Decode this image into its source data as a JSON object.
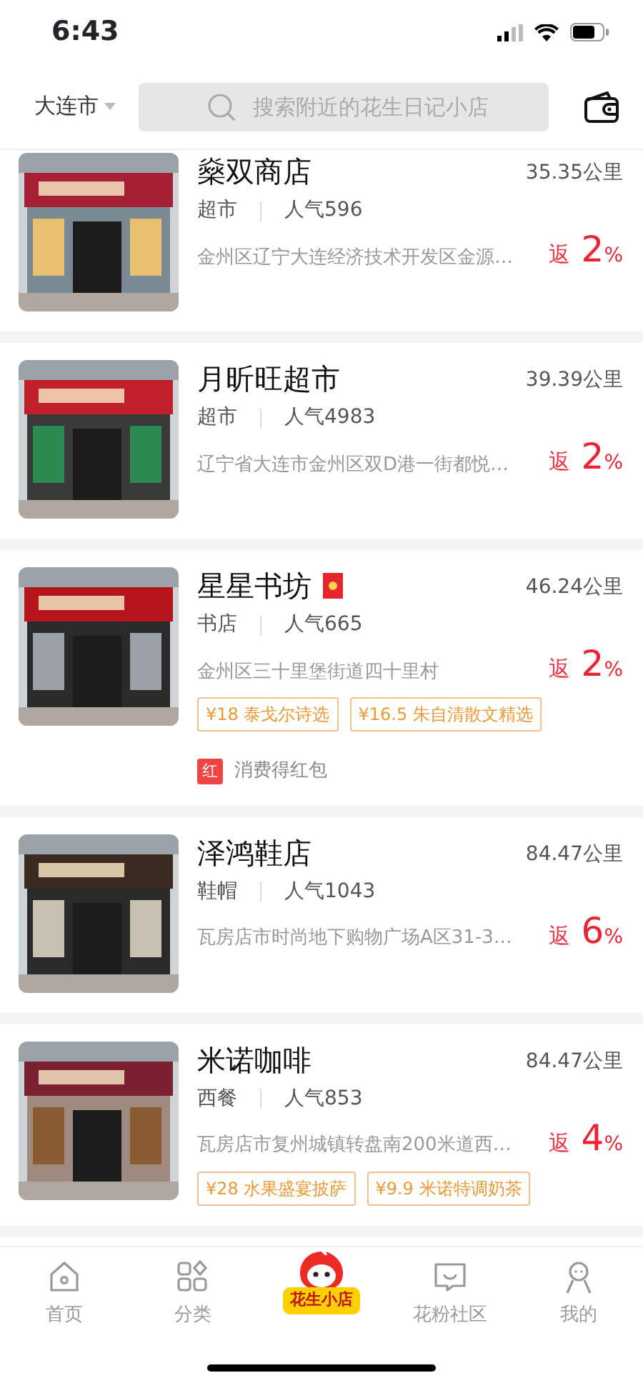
{
  "status_bar": {
    "time": "6:43"
  },
  "header": {
    "city": "大连市",
    "search": {
      "placeholder": "搜索附近的花生日记小店"
    }
  },
  "stores": [
    {
      "name": "燊双商店",
      "red_packet_icon": false,
      "distance": "35.35公里",
      "category": "超市",
      "popularity": "人气596",
      "address": "金州区辽宁大连经济技术开发区金源…",
      "rebate_label": "返",
      "rebate": "2",
      "rebate_unit": "%"
    },
    {
      "name": "月昕旺超市",
      "red_packet_icon": false,
      "distance": "39.39公里",
      "category": "超市",
      "popularity": "人气4983",
      "address": "辽宁省大连市金州区双D港一街都悦…",
      "rebate_label": "返",
      "rebate": "2",
      "rebate_unit": "%"
    },
    {
      "name": "星星书坊",
      "red_packet_icon": true,
      "distance": "46.24公里",
      "category": "书店",
      "popularity": "人气665",
      "address": "金州区三十里堡街道四十里村",
      "rebate_label": "返",
      "rebate": "2",
      "rebate_unit": "%",
      "tags": [
        "¥18 泰戈尔诗选",
        "¥16.5 朱自清散文精选"
      ],
      "promo": {
        "badge": "红",
        "text": "消费得红包"
      }
    },
    {
      "name": "泽鸿鞋店",
      "red_packet_icon": false,
      "distance": "84.47公里",
      "category": "鞋帽",
      "popularity": "人气1043",
      "address": "瓦房店市时尚地下购物广场A区31-3…",
      "rebate_label": "返",
      "rebate": "6",
      "rebate_unit": "%"
    },
    {
      "name": "米诺咖啡",
      "red_packet_icon": false,
      "distance": "84.47公里",
      "category": "西餐",
      "popularity": "人气853",
      "address": "瓦房店市复州城镇转盘南200米道西…",
      "rebate_label": "返",
      "rebate": "4",
      "rebate_unit": "%",
      "tags": [
        "¥28 水果盛宴披萨",
        "¥9.9 米诺特调奶茶"
      ]
    }
  ],
  "tab_bar": [
    {
      "kind": "home",
      "label": "首页",
      "selected": false
    },
    {
      "kind": "category",
      "label": "分类",
      "selected": false
    },
    {
      "kind": "logo",
      "label": "花生小店",
      "selected": true
    },
    {
      "kind": "community",
      "label": "花粉社区",
      "selected": false
    },
    {
      "kind": "me",
      "label": "我的",
      "selected": false
    }
  ]
}
